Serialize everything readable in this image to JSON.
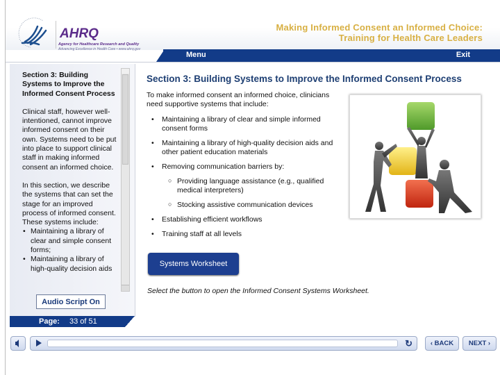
{
  "header": {
    "agency_logo_text": "AHRQ",
    "agency_name": "Agency for Healthcare Research and Quality",
    "agency_tagline": "Advancing Excellence in Health Care • www.ahrq.gov",
    "course_title_line1": "Making Informed Consent an Informed Choice:",
    "course_title_line2": "Training for Health Care Leaders",
    "menu_label": "Menu",
    "exit_label": "Exit"
  },
  "sidebar": {
    "title": "Section 3: Building Systems to Improve the Informed Consent Process",
    "paragraph1": "Clinical staff, however well-intentioned, cannot improve informed consent on their own. Systems need to be put into place to support clinical staff in making informed consent an informed choice.",
    "paragraph2": "In this section, we describe the systems that can set the stage for an improved process of informed consent. These systems include:",
    "items": [
      "Maintaining a library of clear and simple consent forms;",
      "Maintaining a library of high-quality decision aids"
    ],
    "audio_script_label": "Audio Script On",
    "page_label": "Page:",
    "page_value": "33 of 51"
  },
  "main": {
    "title": "Section 3: Building Systems to Improve the Informed Consent Process",
    "intro": "To make informed consent an informed choice, clinicians need supportive systems that include:",
    "bullets": [
      "Maintaining a library of clear and simple informed consent forms",
      "Maintaining a library of high-quality decision aids and other patient education materials",
      "Removing communication barriers by:",
      "Establishing efficient workflows",
      "Training staff at all levels"
    ],
    "sub_bullets": [
      "Providing language assistance (e.g., qualified medical interpreters)",
      "Stocking assistive communication devices"
    ],
    "worksheet_button": "Systems Worksheet",
    "instruction": "Select the button to open the Informed Consent Systems Worksheet.",
    "illustration": "people-stacking-colored-blocks"
  },
  "controls": {
    "mute_icon": "speaker-icon",
    "play_icon": "play-icon",
    "replay_icon": "replay-icon",
    "progress": 0,
    "back_label": "‹ BACK",
    "next_label": "NEXT ›"
  },
  "colors": {
    "navy": "#123b88",
    "title_gold": "#d8b043",
    "heading_blue": "#1e3f73",
    "ahrq_purple": "#5b2b8a"
  }
}
